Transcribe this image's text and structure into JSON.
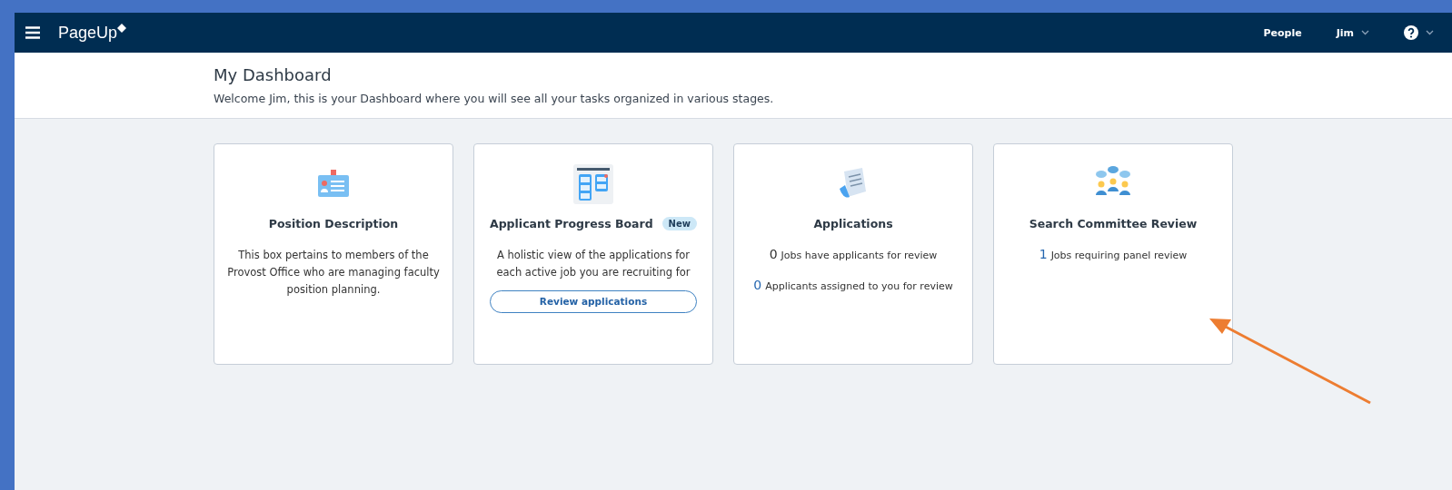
{
  "navbar": {
    "logo": "PageUp",
    "links": [
      {
        "label": "People",
        "dropdown": false
      },
      {
        "label": "Jim",
        "dropdown": true
      }
    ],
    "help": {
      "dropdown": true
    }
  },
  "header": {
    "title": "My Dashboard",
    "subtitle": "Welcome Jim, this is your Dashboard where you will see all your tasks organized in various stages."
  },
  "cards": [
    {
      "kind": "description",
      "title": "Position Description",
      "text": "This box pertains to members of the Provost Office who are managing faculty position planning."
    },
    {
      "kind": "action",
      "title": "Applicant Progress Board",
      "badge": "New",
      "text": "A holistic view of the applications for each active job you are recruiting for",
      "button": "Review applications"
    },
    {
      "kind": "stats",
      "title": "Applications",
      "stats": [
        {
          "count": "0",
          "label": "Jobs have applicants for review",
          "linked": false
        },
        {
          "count": "0",
          "label": "Applicants assigned to you for review",
          "linked": true
        }
      ]
    },
    {
      "kind": "stats",
      "title": "Search Committee Review",
      "stats": [
        {
          "count": "1",
          "label": "Jobs requiring panel review",
          "linked": true
        }
      ]
    }
  ]
}
